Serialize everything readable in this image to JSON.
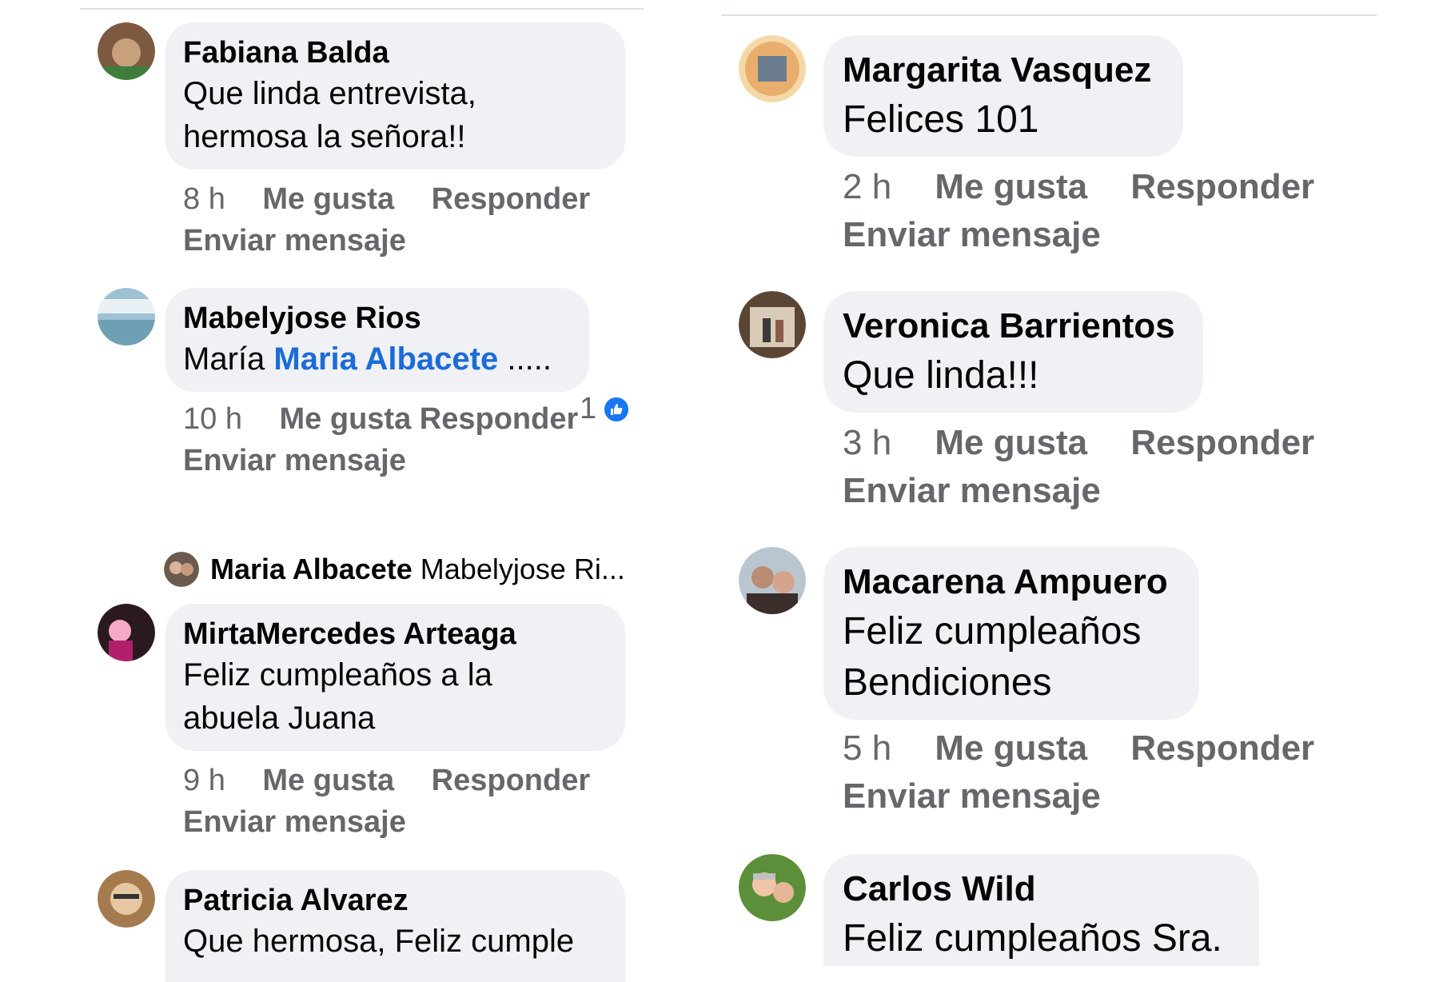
{
  "left_column": {
    "comments": [
      {
        "author": "Fabiana Balda",
        "lines": [
          "Que linda entrevista,",
          "hermosa la señora!!"
        ],
        "time": "8 h",
        "like": "Me gusta",
        "reply": "Responder",
        "message": "Enviar mensaje",
        "avatar_colors": [
          "#7d5a3f",
          "#c9a07c"
        ]
      },
      {
        "author": "Mabelyjose Rios",
        "text_prefix": "María",
        "mention": "Maria Albacete",
        "text_suffix": ".....",
        "time": "10 h",
        "like": "Me gusta",
        "reply": "Responder",
        "message": "Enviar mensaje",
        "reaction_count": "1",
        "avatar_colors": [
          "#9cc1d2",
          "#e9f1f5"
        ]
      },
      {
        "author": "MirtaMercedes Arteaga",
        "lines": [
          "Feliz cumpleaños a la",
          "abuela Juana"
        ],
        "time": "9 h",
        "like": "Me gusta",
        "reply": "Responder",
        "message": "Enviar mensaje",
        "avatar_colors": [
          "#b2206c",
          "#f6a9c6"
        ]
      },
      {
        "author": "Patricia Alvarez",
        "lines": [
          "Que hermosa, Feliz cumple"
        ],
        "avatar_colors": [
          "#a57a4e",
          "#e5c7a1"
        ]
      }
    ],
    "reply_preview": {
      "author": "Maria Albacete",
      "text": "Mabelyjose Ri..."
    }
  },
  "right_column": {
    "comments": [
      {
        "author": "Margarita Vasquez",
        "lines": [
          "Felices 101"
        ],
        "time": "2 h",
        "like": "Me gusta",
        "reply": "Responder",
        "message": "Enviar mensaje",
        "avatar_colors": [
          "#e08a3c",
          "#f4d9a8"
        ]
      },
      {
        "author": "Veronica Barrientos",
        "lines": [
          "Que linda!!!"
        ],
        "time": "3 h",
        "like": "Me gusta",
        "reply": "Responder",
        "message": "Enviar mensaje",
        "avatar_colors": [
          "#5b4636",
          "#d8cbb8"
        ]
      },
      {
        "author": "Macarena Ampuero",
        "lines": [
          "Feliz cumpleaños",
          "Bendiciones"
        ],
        "time": "5 h",
        "like": "Me gusta",
        "reply": "Responder",
        "message": "Enviar mensaje",
        "avatar_colors": [
          "#3c2e2a",
          "#b98c74"
        ]
      },
      {
        "author": "Carlos Wild",
        "lines": [
          "Feliz cumpleaños Sra."
        ],
        "avatar_colors": [
          "#5b8f3a",
          "#f0c6a8"
        ]
      }
    ]
  },
  "colors": {
    "bubble_bg": "#eff1f4",
    "meta_text": "#65676b",
    "mention": "#1c6bd8",
    "like_badge": "#1877f2"
  }
}
